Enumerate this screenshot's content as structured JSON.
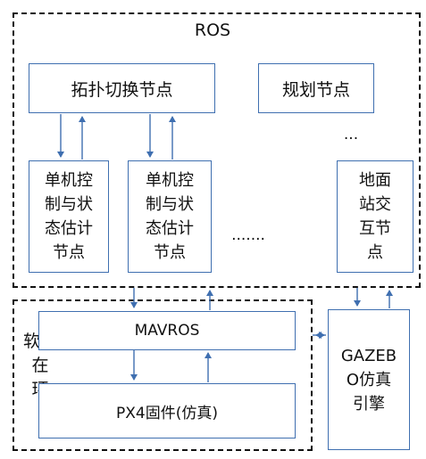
{
  "diagram": {
    "ros_group": {
      "label": "ROS"
    },
    "sil_group": {
      "label": "软件\n在\n环"
    },
    "nodes": {
      "topology_switch": "拓扑切换节点",
      "planning": "规划节点",
      "controller_1": "单机控\n制与状\n态估计\n节点",
      "controller_2": "单机控\n制与状\n态估计\n节点",
      "ground_station": "地面\n站交\n互节\n点",
      "mavros": "MAVROS",
      "px4": "PX4固件(仿真)",
      "gazebo": "GAZEB\nO仿真\n引擎"
    },
    "ellipsis_top": "...",
    "ellipsis_mid": "......."
  }
}
